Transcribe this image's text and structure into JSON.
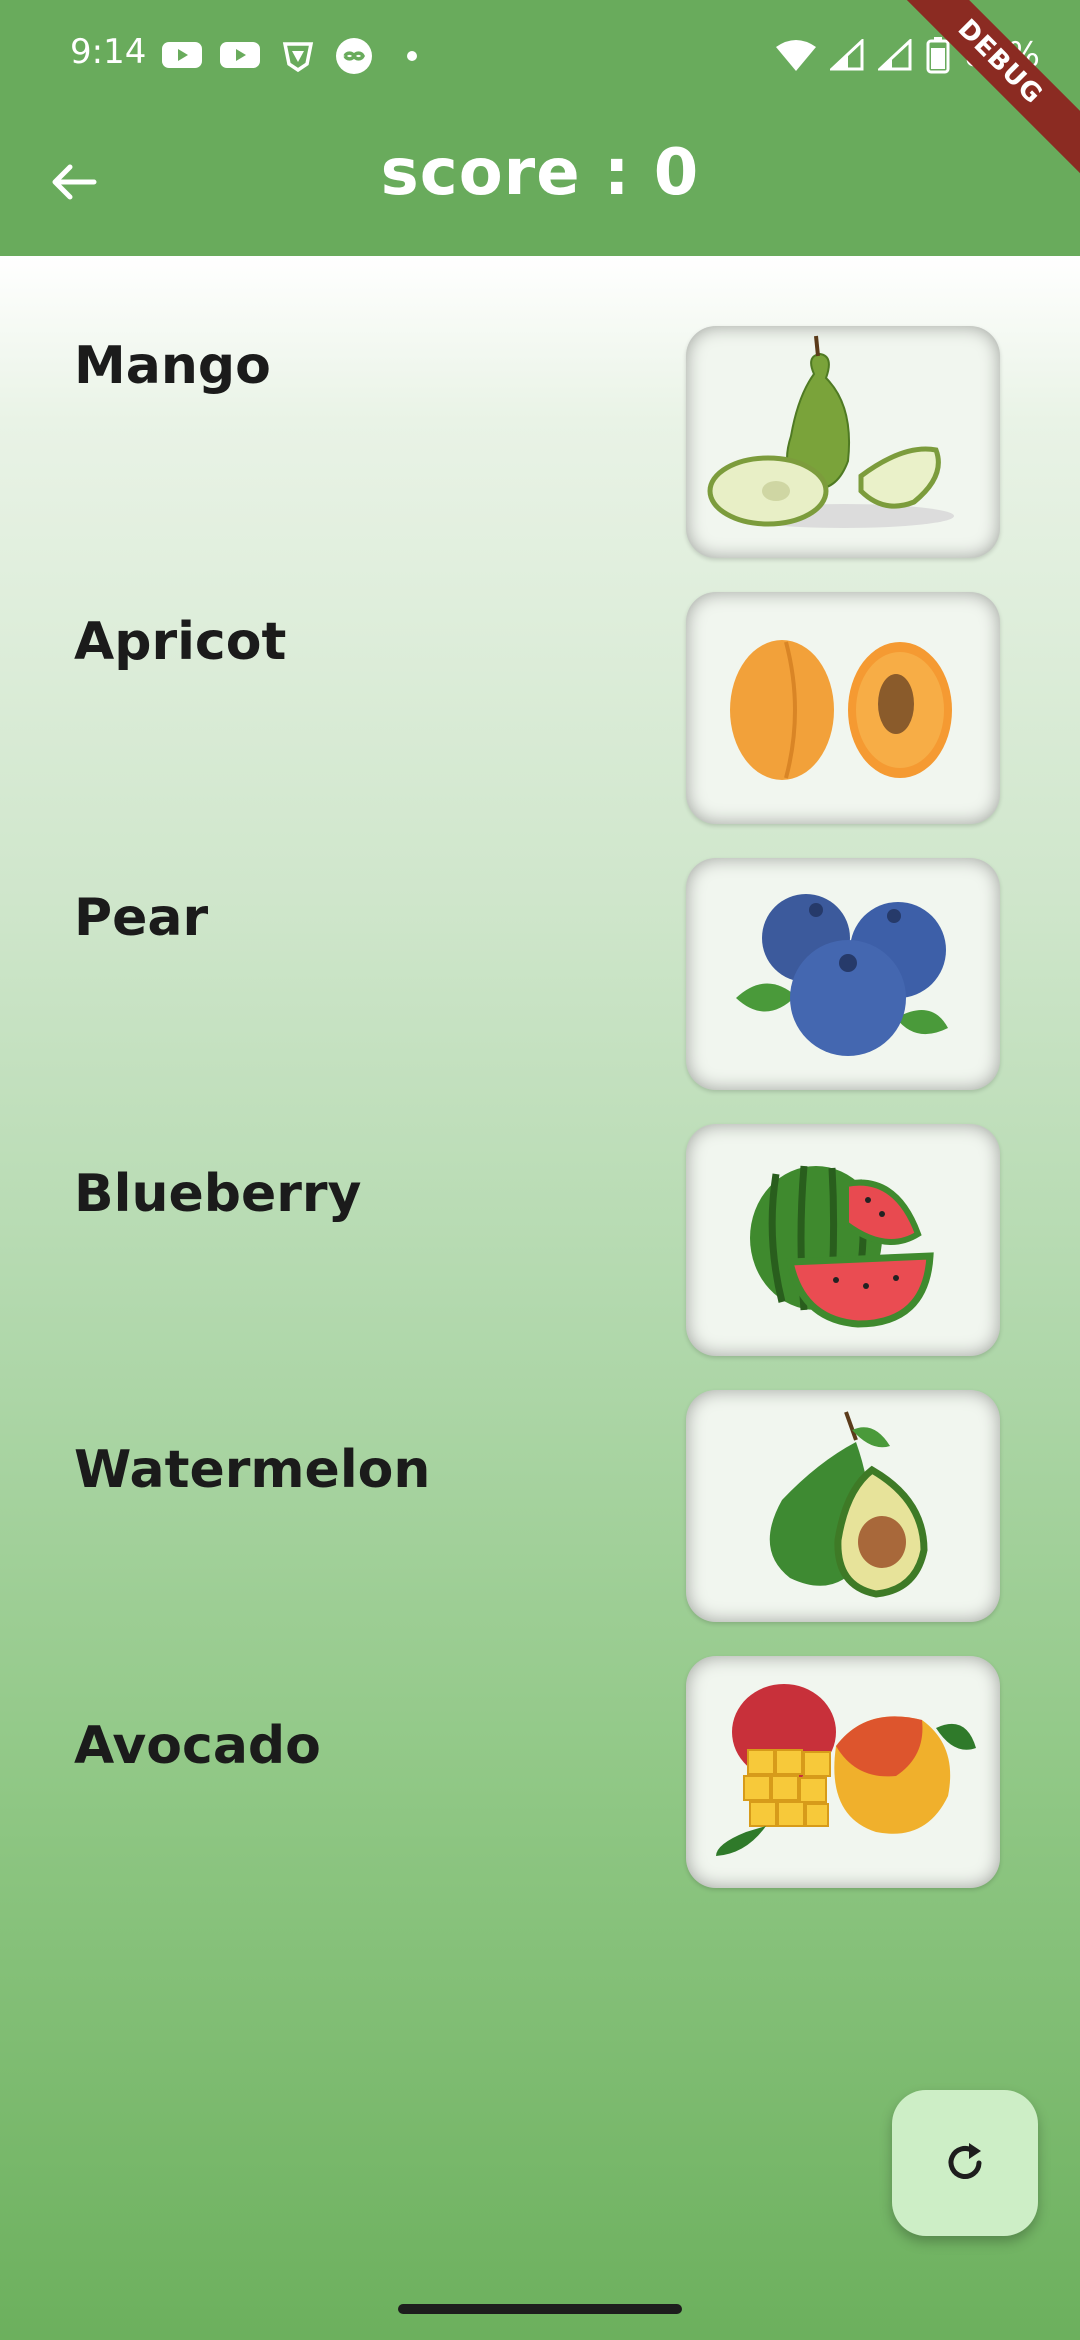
{
  "status_bar": {
    "time": "9:14",
    "battery": "80%",
    "icons": [
      "youtube-icon",
      "youtube-icon",
      "brave-icon",
      "link-icon",
      "dot-icon",
      "wifi-icon",
      "signal-icon",
      "signal-icon",
      "battery-icon"
    ]
  },
  "app_bar": {
    "title": "score :  0",
    "back_icon": "arrow-left-icon",
    "color": "#69ab5c"
  },
  "debug_banner": "DEBUG",
  "rows": [
    {
      "label": "Mango",
      "image": "pear"
    },
    {
      "label": "Apricot",
      "image": "apricot"
    },
    {
      "label": "Pear",
      "image": "blueberry"
    },
    {
      "label": "Blueberry",
      "image": "watermelon"
    },
    {
      "label": "Watermelon",
      "image": "avocado"
    },
    {
      "label": "Avocado",
      "image": "mango"
    }
  ],
  "fab": {
    "icon": "refresh-icon",
    "color": "#cdeec6"
  }
}
